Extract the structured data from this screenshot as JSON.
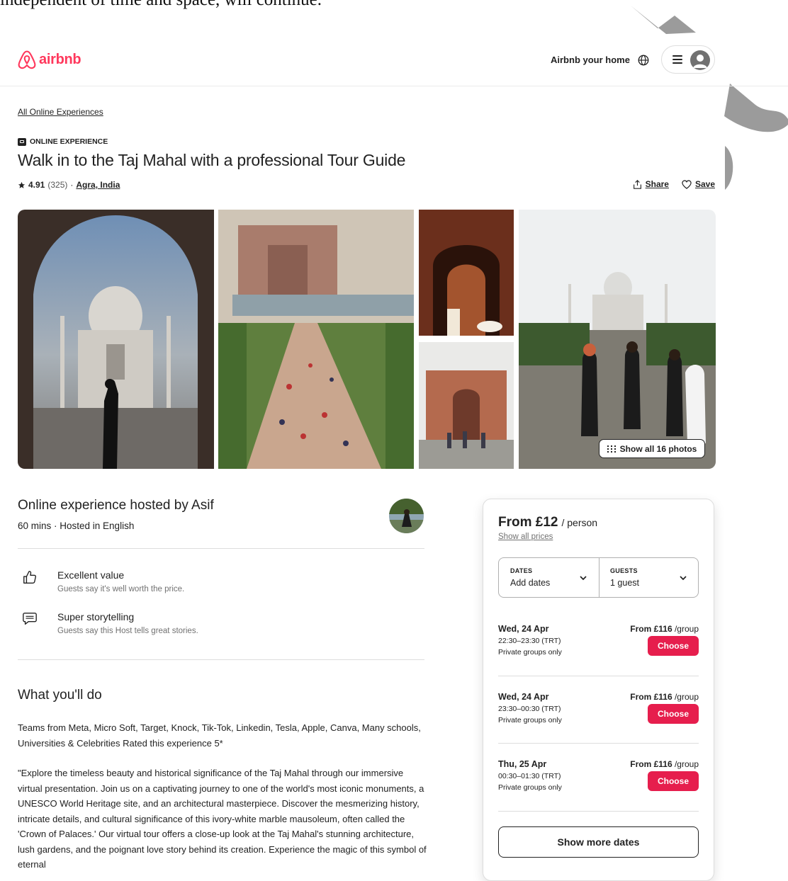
{
  "stray_text": "independent of time and space, will continue.",
  "header": {
    "logo_text": "airbnb",
    "host_link": "Airbnb your home",
    "brand_color": "#ff385c"
  },
  "breadcrumb": "All Online Experiences",
  "experience_type": "ONLINE EXPERIENCE",
  "title": "Walk in to the Taj Mahal with a professional Tour Guide",
  "rating": "4.91",
  "review_count": "(325)",
  "separator": "·",
  "location": "Agra, India",
  "actions": {
    "share": "Share",
    "save": "Save"
  },
  "gallery": {
    "show_all_label": "Show all 16 photos"
  },
  "host": {
    "title": "Online experience hosted by Asif",
    "subtitle": "60 mins · Hosted in English"
  },
  "features": [
    {
      "title": "Excellent value",
      "desc": "Guests say it's well worth the price.",
      "icon": "thumbs-up-icon"
    },
    {
      "title": "Super storytelling",
      "desc": "Guests say this Host tells great stories.",
      "icon": "speech-bubble-icon"
    }
  ],
  "what_youll_do": {
    "title": "What you'll do",
    "paragraphs": [
      "Teams from Meta, Micro Soft, Target, Knock, Tik-Tok, Linkedin, Tesla, Apple, Canva, Many schools, Universities & Celebrities Rated this experience 5*",
      "\"Explore the timeless beauty and historical significance of the Taj Mahal through our immersive virtual presentation. Join us on a captivating journey to one of the world's most iconic monuments, a UNESCO World Heritage site, and an architectural masterpiece. Discover the mesmerizing history, intricate details, and cultural significance of this ivory-white marble mausoleum, often called the 'Crown of Palaces.' Our virtual tour offers a close-up look at the Taj Mahal's stunning architecture, lush gardens, and the poignant love story behind its creation. Experience the magic of this symbol of eternal"
    ]
  },
  "booking": {
    "price_from": "From £12",
    "price_unit": "/ person",
    "show_all_prices": "Show all prices",
    "dates_label": "DATES",
    "dates_value": "Add dates",
    "guests_label": "GUESTS",
    "guests_value": "1 guest",
    "accent_color": "#e61e4d",
    "slots": [
      {
        "date": "Wed, 24 Apr",
        "time": "22:30–23:30 (TRT)",
        "note": "Private groups only",
        "price": "From £116",
        "unit": "/group",
        "button": "Choose"
      },
      {
        "date": "Wed, 24 Apr",
        "time": "23:30–00:30 (TRT)",
        "note": "Private groups only",
        "price": "From £116",
        "unit": "/group",
        "button": "Choose"
      },
      {
        "date": "Thu, 25 Apr",
        "time": "00:30–01:30 (TRT)",
        "note": "Private groups only",
        "price": "From £116",
        "unit": "/group",
        "button": "Choose"
      }
    ],
    "show_more_dates": "Show more dates"
  }
}
